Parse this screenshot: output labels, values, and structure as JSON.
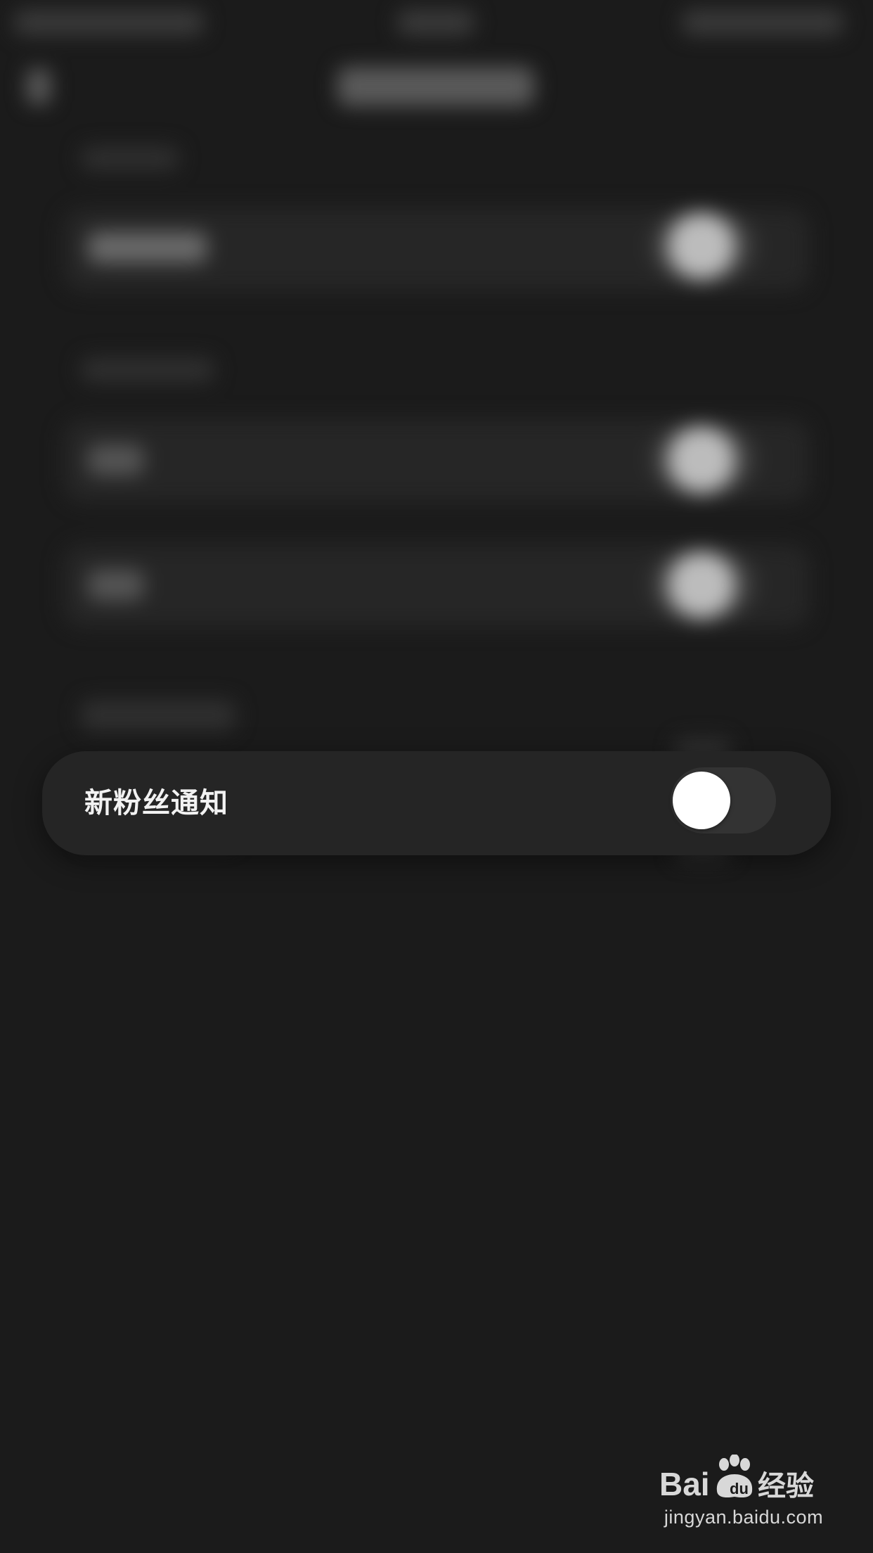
{
  "card": {
    "label": "新粉丝通知",
    "toggle_on": false
  },
  "watermark": {
    "logo_text": "Bai du 经验",
    "url": "jingyan.baidu.com"
  },
  "colors": {
    "background": "#1b1b1b",
    "card": "#252525",
    "toggle_track": "#333333",
    "toggle_knob": "#ffffff",
    "text": "#f2f2f2"
  }
}
